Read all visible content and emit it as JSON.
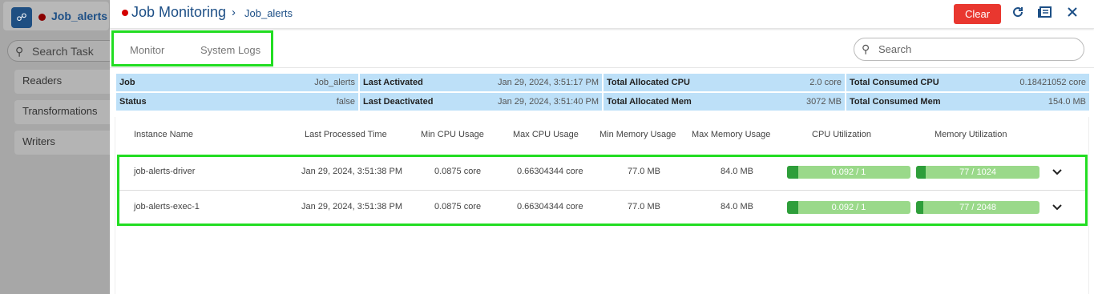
{
  "background_app": {
    "title": "Job_alerts",
    "search_placeholder": "Search Task",
    "side_items": [
      "Readers",
      "Transformations",
      "Writers"
    ]
  },
  "header": {
    "title": "Job Monitoring",
    "breadcrumb": "Job_alerts",
    "clear_label": "Clear",
    "status_color": "#d40000",
    "icons": [
      "refresh-icon",
      "list-icon",
      "close-icon"
    ]
  },
  "tabs": [
    {
      "label": "Monitor"
    },
    {
      "label": "System Logs"
    }
  ],
  "search": {
    "placeholder": "Search",
    "value": ""
  },
  "summary": {
    "job": {
      "label": "Job",
      "value": "Job_alerts"
    },
    "status": {
      "label": "Status",
      "value": "false"
    },
    "last_activated": {
      "label": "Last Activated",
      "value": "Jan 29, 2024, 3:51:17 PM"
    },
    "last_deactivated": {
      "label": "Last Deactivated",
      "value": "Jan 29, 2024, 3:51:40 PM"
    },
    "total_alloc_cpu": {
      "label": "Total Allocated CPU",
      "value": "2.0 core"
    },
    "total_alloc_mem": {
      "label": "Total Allocated Mem",
      "value": "3072 MB"
    },
    "total_cons_cpu": {
      "label": "Total Consumed CPU",
      "value": "0.18421052 core"
    },
    "total_cons_mem": {
      "label": "Total Consumed Mem",
      "value": "154.0 MB"
    }
  },
  "table": {
    "headers": [
      "Instance Name",
      "Last Processed Time",
      "Min CPU Usage",
      "Max CPU Usage",
      "Min Memory Usage",
      "Max Memory Usage",
      "CPU Utilization",
      "Memory Utilization"
    ],
    "rows": [
      {
        "name": "job-alerts-driver",
        "last_processed": "Jan 29, 2024, 3:51:38 PM",
        "min_cpu": "0.0875 core",
        "max_cpu": "0.66304344 core",
        "min_mem": "77.0 MB",
        "max_mem": "84.0 MB",
        "cpu_util": {
          "label": "0.092 / 1",
          "fraction": 0.092
        },
        "mem_util": {
          "label": "77 / 1024",
          "fraction": 0.075
        }
      },
      {
        "name": "job-alerts-exec-1",
        "last_processed": "Jan 29, 2024, 3:51:38 PM",
        "min_cpu": "0.0875 core",
        "max_cpu": "0.66304344 core",
        "min_mem": "77.0 MB",
        "max_mem": "84.0 MB",
        "cpu_util": {
          "label": "0.092 / 1",
          "fraction": 0.092
        },
        "mem_util": {
          "label": "77 / 2048",
          "fraction": 0.038
        }
      }
    ]
  }
}
